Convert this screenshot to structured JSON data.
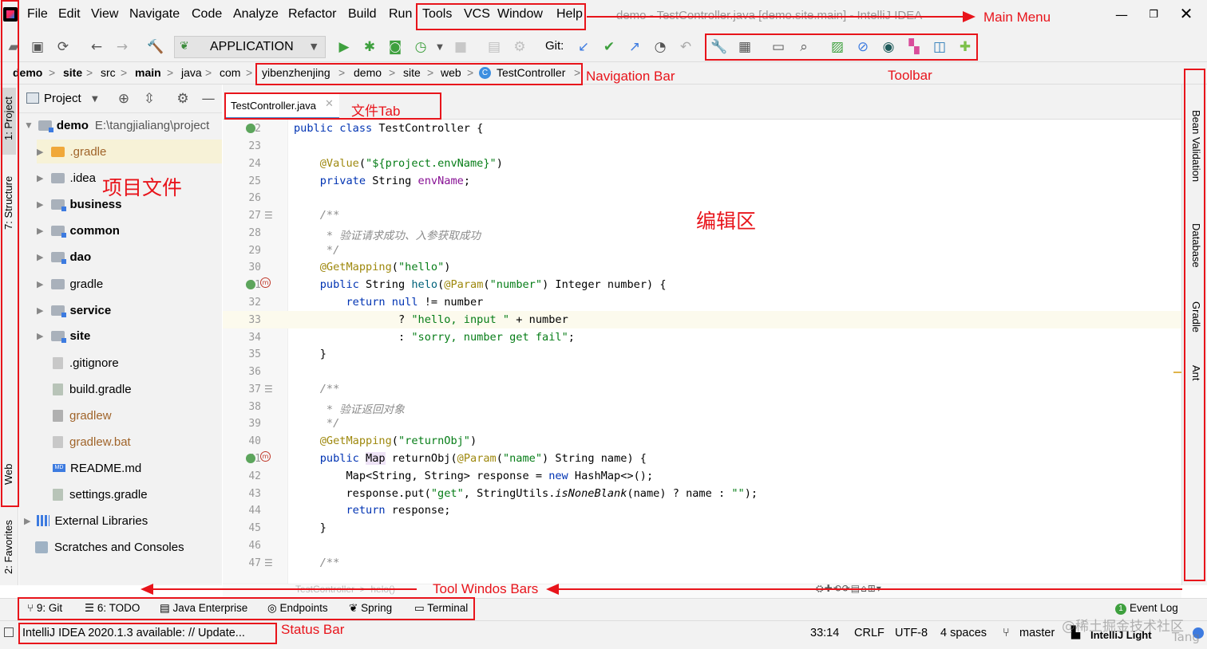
{
  "menu": {
    "items": [
      "File",
      "Edit",
      "View",
      "Navigate",
      "Code",
      "Analyze",
      "Refactor",
      "Build",
      "Run",
      "Tools",
      "VCS",
      "Window",
      "Help"
    ],
    "window_title": "demo - TestController.java [demo.site.main] - IntelliJ IDEA"
  },
  "toolbar": {
    "run_config": "APPLICATION",
    "git_label": "Git:"
  },
  "nav": {
    "crumbs": [
      "demo",
      "site",
      "src",
      "main",
      "java",
      "com",
      "yibenzhenjing",
      "demo",
      "site",
      "web",
      "TestController"
    ],
    "class_badge": "C"
  },
  "left_stripe": {
    "tabs": [
      "1: Project",
      "7: Structure",
      "Web",
      "2: Favorites"
    ]
  },
  "project": {
    "header_label": "Project",
    "root_name": "demo",
    "root_path": "E:\\tangjialiang\\project",
    "items": [
      ".gradle",
      ".idea",
      "business",
      "common",
      "dao",
      "gradle",
      "service",
      "site",
      ".gitignore",
      "build.gradle",
      "gradlew",
      "gradlew.bat",
      "README.md",
      "settings.gradle",
      "External Libraries",
      "Scratches and Consoles"
    ],
    "md_badge": "MD"
  },
  "editor": {
    "tab_label": "TestController.java",
    "line_numbers": [
      "22",
      "23",
      "24",
      "25",
      "26",
      "27",
      "28",
      "29",
      "30",
      "31",
      "32",
      "33",
      "34",
      "35",
      "36",
      "37",
      "38",
      "39",
      "40",
      "41",
      "42",
      "43",
      "44",
      "45",
      "46",
      "47"
    ],
    "breadcrumb": "TestController  >  helo()"
  },
  "right_stripe": {
    "tabs": [
      "Bean Validation",
      "Database",
      "Gradle",
      "Ant"
    ]
  },
  "tool_windows": {
    "items": [
      "9: Git",
      "6: TODO",
      "Java Enterprise",
      "Endpoints",
      "Spring",
      "Terminal"
    ],
    "event_log": "Event Log",
    "event_badge": "1"
  },
  "status": {
    "message": "IntelliJ IDEA 2020.1.3 available: // Update...",
    "position": "33:14",
    "line_sep": "CRLF",
    "encoding": "UTF-8",
    "indent": "4 spaces",
    "branch": "master",
    "theme": "IntelliJ Light",
    "watermark": "@稀土掘金技术社区",
    "watermark_user": "Tang"
  },
  "annotations": {
    "main_menu": "Main Menu",
    "navigation_bar": "Navigation Bar",
    "toolbar": "Toolbar",
    "file_tab": "文件Tab",
    "project_files": "项目文件",
    "editor_area": "编辑区",
    "tool_windows_bars": "Tool Windos Bars",
    "status_bar": "Status Bar"
  },
  "colors": {
    "annotation": "#e8141b",
    "keyword": "#0033b3",
    "string": "#067d17",
    "annotation_code": "#9e880d",
    "comment": "#8c8c8c"
  }
}
